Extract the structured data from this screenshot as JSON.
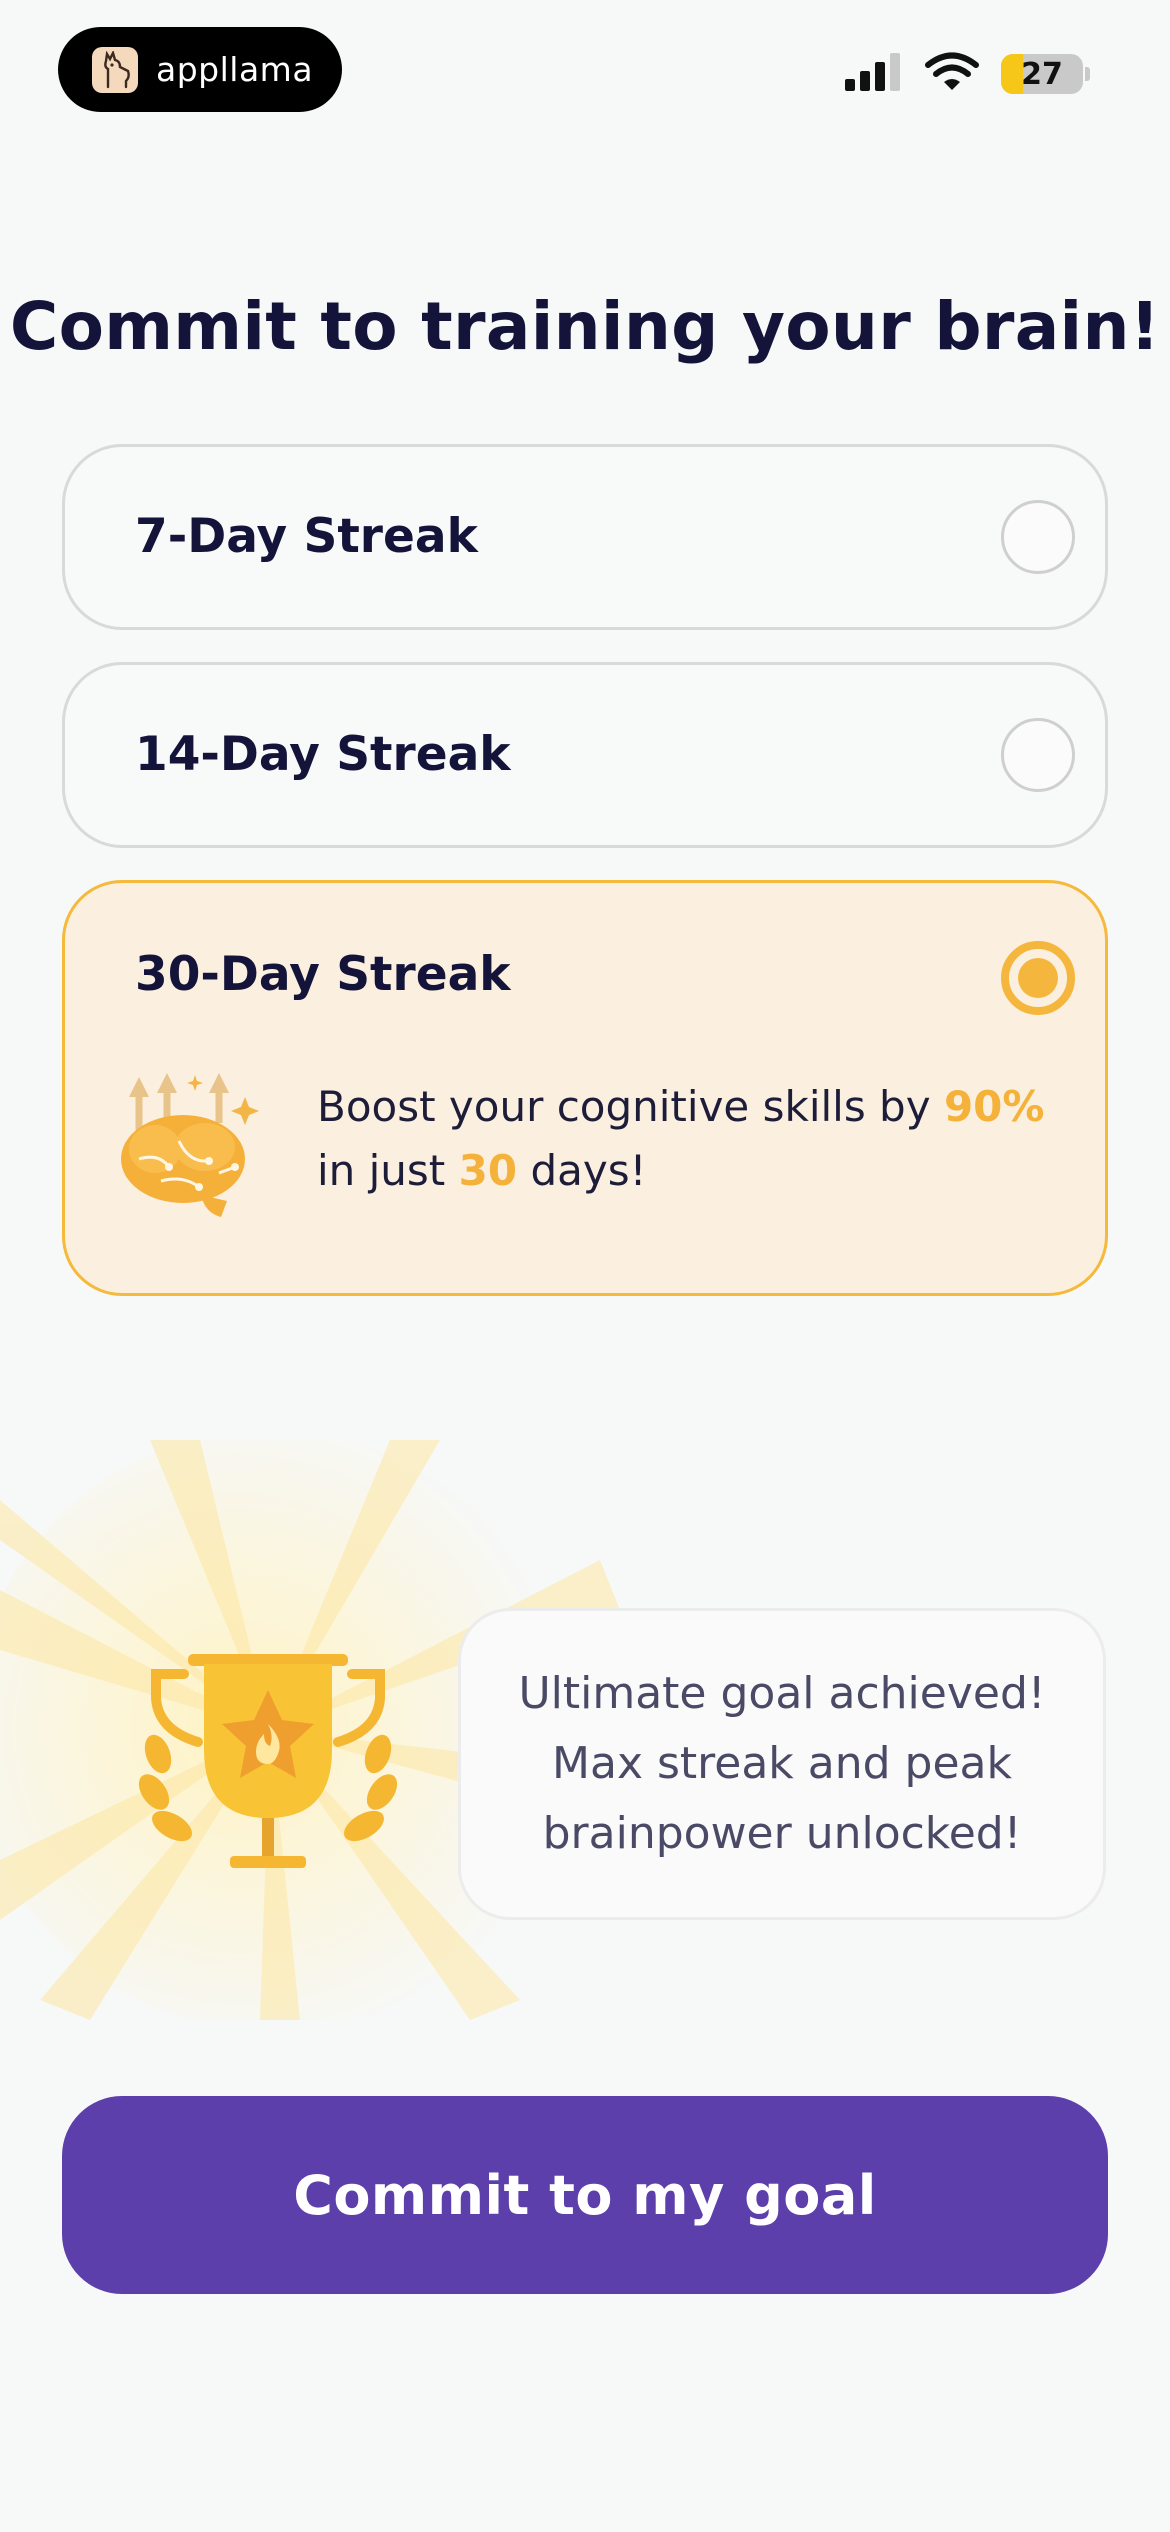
{
  "status_bar": {
    "brand": "appllama",
    "battery_level": 27,
    "battery_text": "27",
    "logo_icon": "llama-icon",
    "signal_icon": "cellular-signal-icon",
    "wifi_icon": "wifi-icon"
  },
  "title": "Commit to training your brain!",
  "options": [
    {
      "label": "7-Day Streak",
      "selected": false
    },
    {
      "label": "14-Day Streak",
      "selected": false
    },
    {
      "label": "30-Day Streak",
      "selected": true
    }
  ],
  "boost": {
    "prefix": "Boost your cognitive skills by ",
    "percent": "90%",
    "middle": " in just ",
    "days": "30",
    "suffix": " days!",
    "icon": "brain-icon"
  },
  "reward": {
    "icon": "trophy-icon",
    "message": "Ultimate goal achieved! Max streak and peak brainpower unlocked!"
  },
  "cta": {
    "label": "Commit to my goal"
  },
  "colors": {
    "accent": "#f5b63d",
    "primary": "#5c3fab",
    "selected_bg": "#fbefdf",
    "title": "#14143a"
  }
}
